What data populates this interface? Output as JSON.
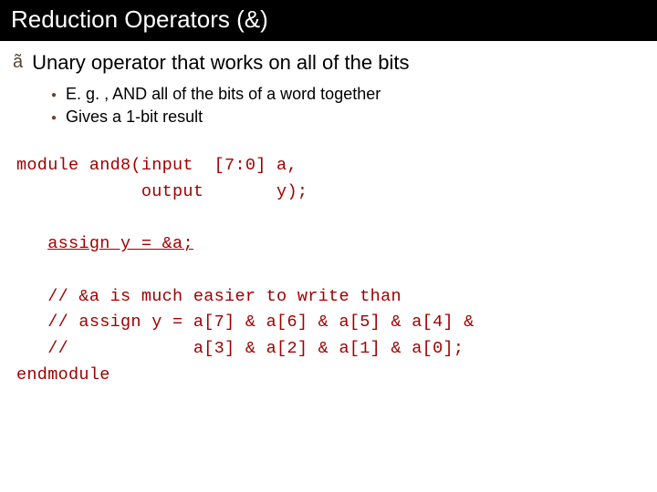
{
  "title": "Reduction Operators (&)",
  "main_bullet": {
    "marker": "ã",
    "text": "Unary operator that works on all of the bits"
  },
  "sub_bullets": [
    "E. g. , AND all of the bits of a word together",
    "Gives a 1-bit result"
  ],
  "code": {
    "line1": "module and8(input  [7:0] a,",
    "line2": "            output       y);",
    "line3": "",
    "line4_pre": "   ",
    "line4_underline": "assign y = &a;",
    "line5": "",
    "line6": "   // &a is much easier to write than",
    "line7": "   // assign y = a[7] & a[6] & a[5] & a[4] &",
    "line8": "   //            a[3] & a[2] & a[1] & a[0];",
    "line9": "endmodule"
  }
}
